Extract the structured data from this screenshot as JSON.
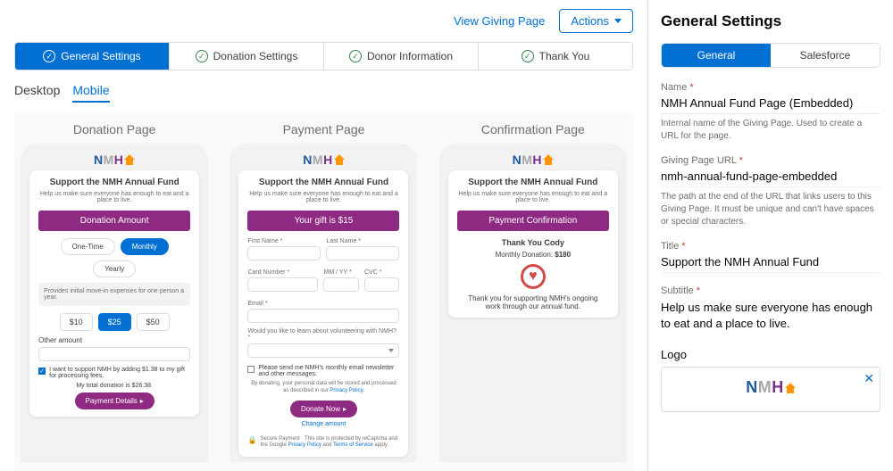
{
  "header": {
    "view_link": "View Giving Page",
    "actions": "Actions"
  },
  "step_tabs": [
    "General Settings",
    "Donation Settings",
    "Donor Information",
    "Thank You"
  ],
  "device_tabs": {
    "desktop": "Desktop",
    "mobile": "Mobile"
  },
  "previews": {
    "donation_title": "Donation Page",
    "payment_title": "Payment Page",
    "confirmation_title": "Confirmation Page"
  },
  "phone_common": {
    "headline": "Support the NMH Annual Fund",
    "subhead": "Help us make sure everyone has enough to eat and a place to live."
  },
  "donation": {
    "section_title": "Donation Amount",
    "freq_one": "One-Time",
    "freq_month": "Monthly",
    "freq_year": "Yearly",
    "hint": "Provides initial move-in expenses for one person a year.",
    "amt10": "$10",
    "amt25": "$25",
    "amt50": "$50",
    "other_label": "Other amount",
    "check_text": "I want to support NMH by adding $1.38 to my gift for processing fees.",
    "total_text": "My total donation is $26.38.",
    "details_btn": "Payment Details"
  },
  "payment": {
    "section_title": "Your gift is $15",
    "first_name": "First Name *",
    "last_name": "Last Name *",
    "card_num": "Card Number *",
    "exp": "MM / YY *",
    "cvc": "CVC *",
    "email": "Email *",
    "volunteer_q": "Would you like to learn about volunteering with NMH? *",
    "newsletter": "Please send me NMH's monthly email newsletter and other messages.",
    "disclaim_pre": "By donating, your personal data will be stored and processed as described in our ",
    "disclaim_link": "Privacy Policy",
    "donate_btn": "Donate Now",
    "change": "Change amount",
    "secure_pre": "Secure Payment · This site is protected by reCaptcha and the Google ",
    "secure_pp": "Privacy Policy",
    "secure_and": " and ",
    "secure_tos": "Terms of Service",
    "secure_apply": " apply."
  },
  "confirm": {
    "section_title": "Payment Confirmation",
    "thank": "Thank You Cody",
    "summary_pre": "Monthly Donation: ",
    "summary_amt": "$180",
    "msg": "Thank you for supporting NMH's ongoing work through our annual fund."
  },
  "settings": {
    "panel_title": "General Settings",
    "tab_general": "General",
    "tab_sf": "Salesforce",
    "name_label": "Name",
    "name_value": "NMH Annual Fund Page (Embedded)",
    "name_help": "Internal name of the Giving Page. Used to create a URL for the page.",
    "url_label": "Giving Page URL",
    "url_value": "nmh-annual-fund-page-embedded",
    "url_help": "The path at the end of the URL that links users to this Giving Page. It must be unique and can't have spaces or special characters.",
    "title_label": "Title",
    "title_value": "Support the NMH Annual Fund",
    "subtitle_label": "Subtitle",
    "subtitle_value": "Help us make sure everyone has enough to eat and a place to live.",
    "logo_label": "Logo"
  }
}
